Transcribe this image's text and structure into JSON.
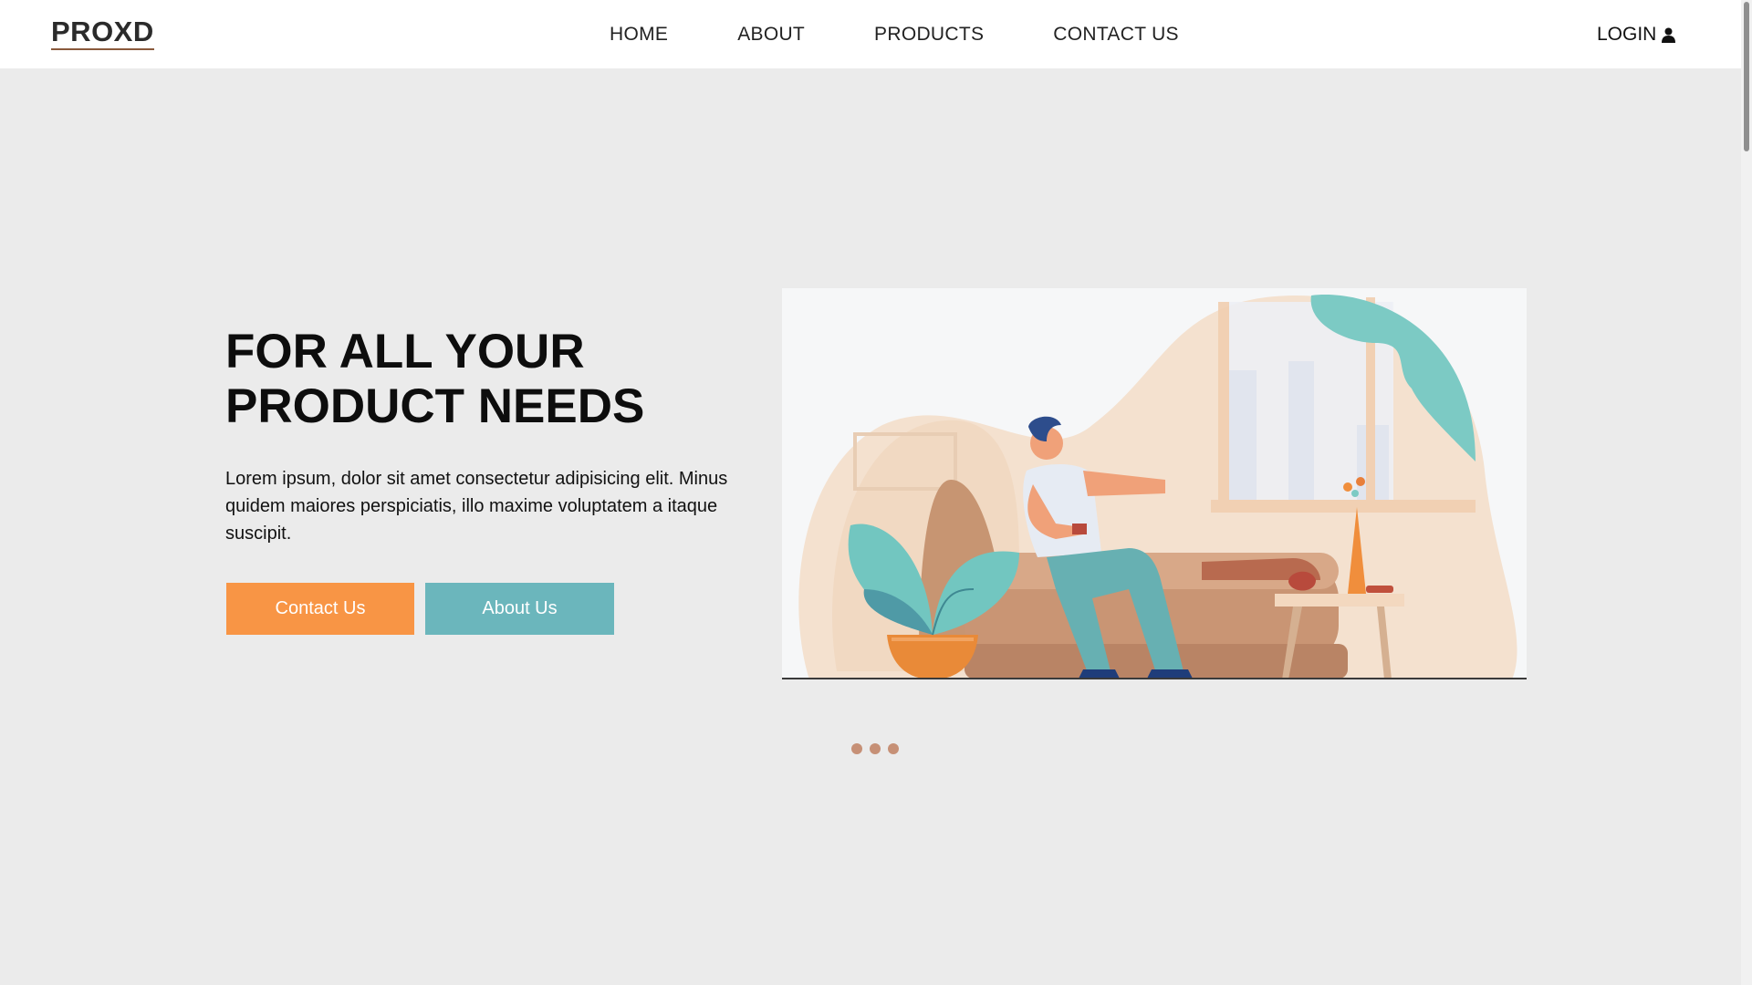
{
  "header": {
    "logo": "PROXD",
    "nav": [
      "HOME",
      "ABOUT",
      "PRODUCTS",
      "CONTACT US"
    ],
    "login_label": "LOGIN",
    "login_icon": "user-icon"
  },
  "hero": {
    "title_line1": "FOR ALL YOUR",
    "title_line2": "PRODUCT NEEDS",
    "description": "Lorem ipsum, dolor sit amet consectetur adipisicing elit. Minus quidem maiores perspiciatis, illo maxime voluptatem a itaque suscipit.",
    "contact_button": "Contact Us",
    "about_button": "About Us"
  },
  "carousel": {
    "dot_count": 3
  },
  "colors": {
    "accent_orange": "#f89545",
    "accent_teal": "#6bb6bc",
    "dot": "#c69076",
    "background": "#ebebeb"
  }
}
